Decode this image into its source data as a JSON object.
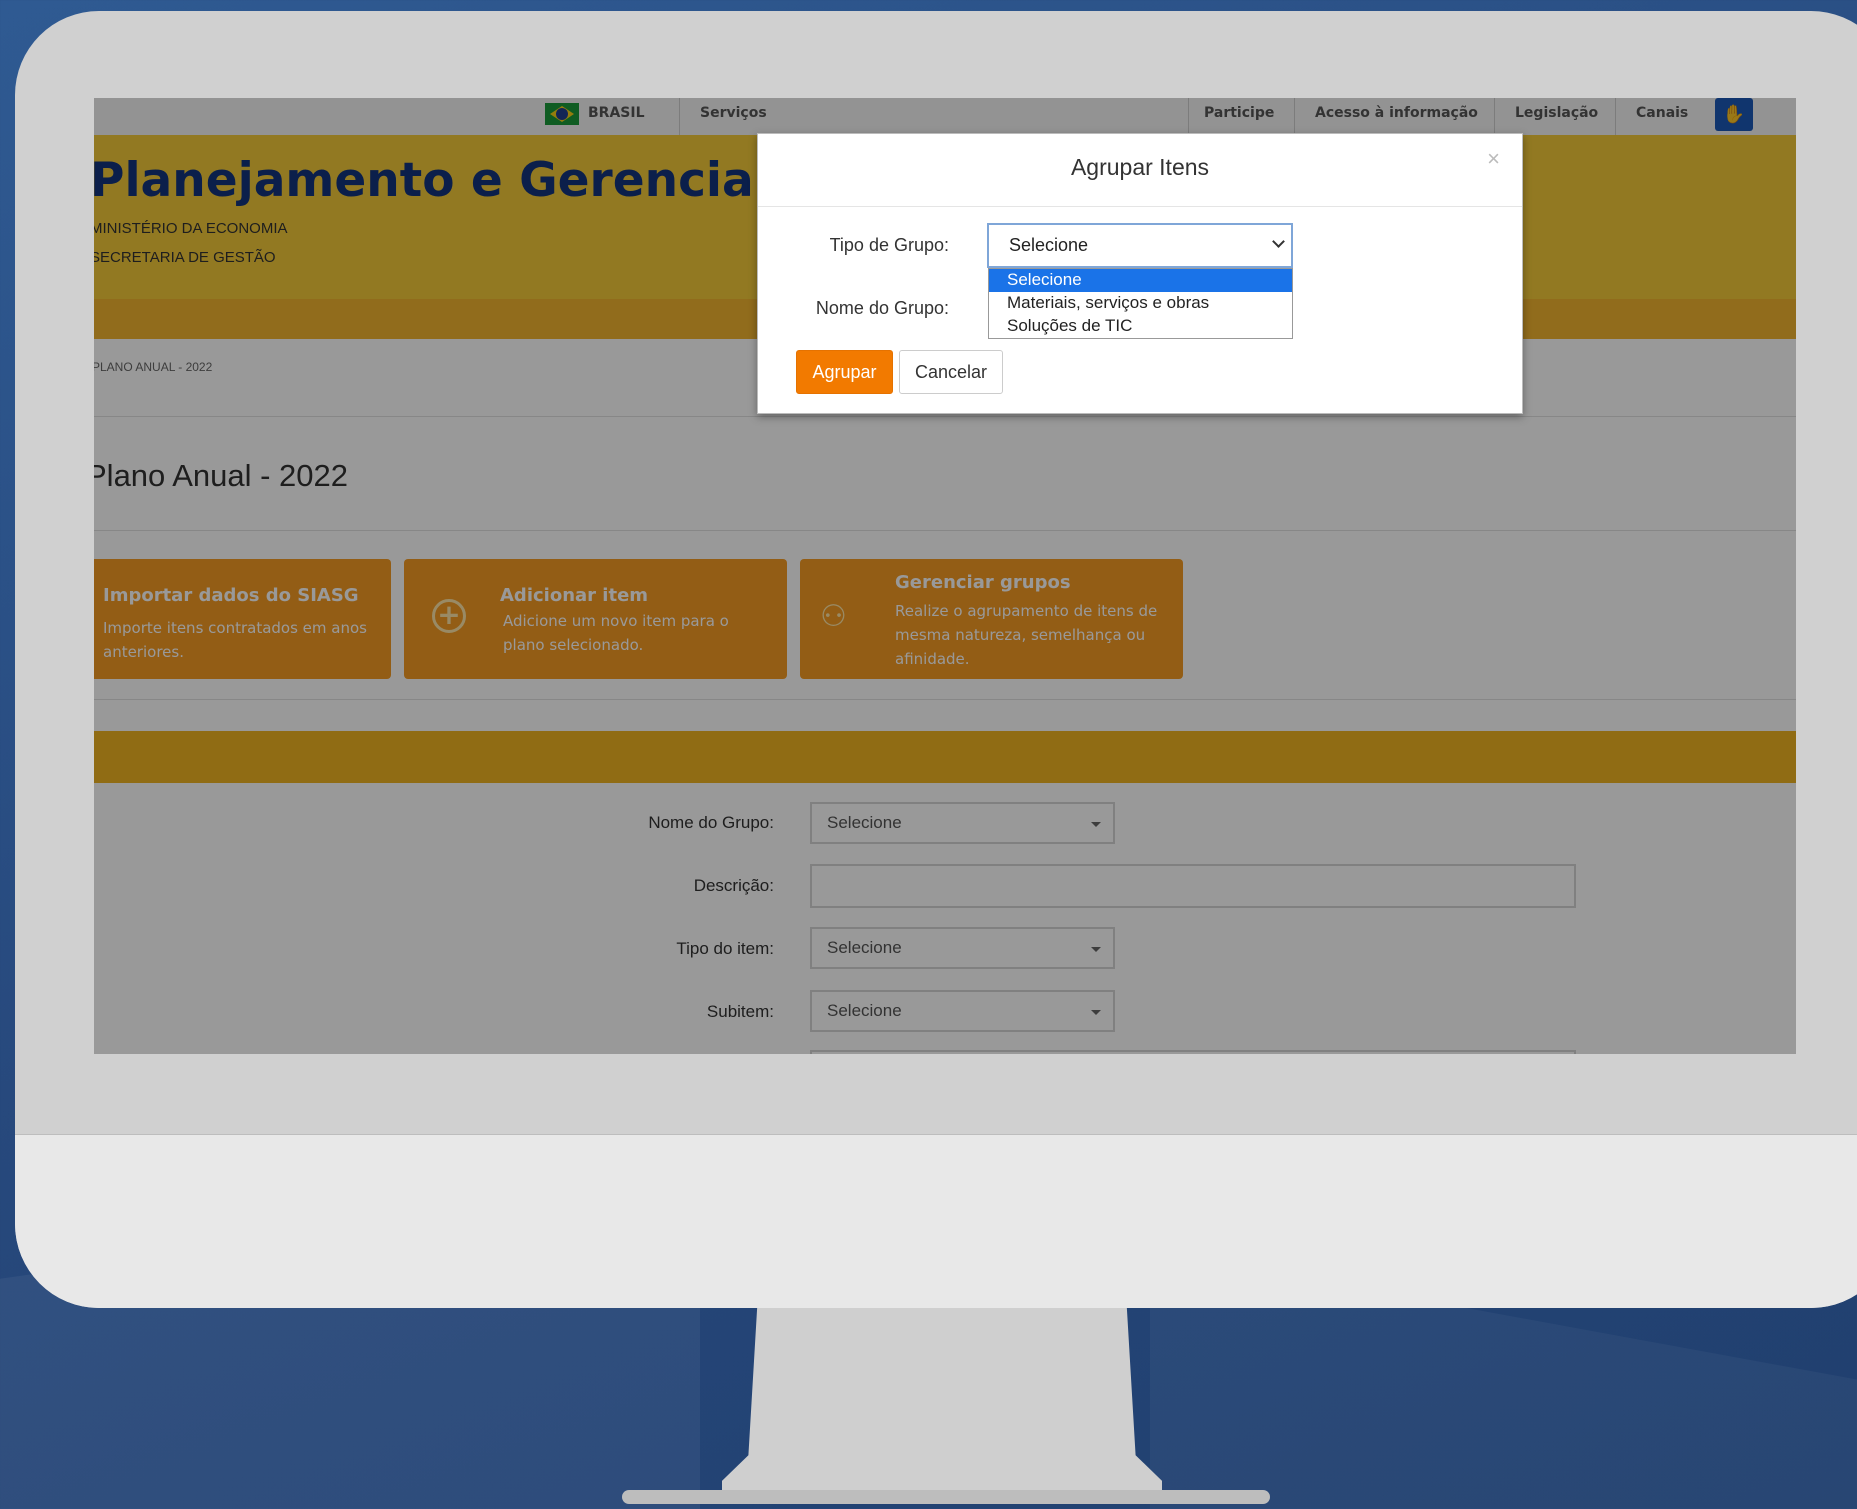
{
  "topbar": {
    "country": "BRASIL",
    "services": "Serviços",
    "links": [
      "Participe",
      "Acesso à informação",
      "Legislação",
      "Canais"
    ]
  },
  "header": {
    "title": "Planejamento e Gerenciamento",
    "ministry": "MINISTÉRIO DA ECONOMIA",
    "secretariat": "SECRETARIA DE GESTÃO"
  },
  "breadcrumb": "PLANO ANUAL - 2022",
  "page_title": "Plano Anual - 2022",
  "cards": [
    {
      "title": "Importar dados do SIASG",
      "description": "Importe itens contratados em anos anteriores."
    },
    {
      "title": "Adicionar item",
      "description": "Adicione um novo item para o plano selecionado."
    },
    {
      "title": "Gerenciar grupos",
      "description": "Realize o agrupamento de itens de mesma natureza, semelhança ou afinidade."
    }
  ],
  "form": {
    "group_name_label": "Nome do Grupo:",
    "group_name_value": "Selecione",
    "description_label": "Descrição:",
    "item_type_label": "Tipo do item:",
    "item_type_value": "Selecione",
    "subitem_label": "Subitem:",
    "subitem_value": "Selecione"
  },
  "modal": {
    "title": "Agrupar Itens",
    "close": "×",
    "group_type_label": "Tipo de Grupo:",
    "group_type_value": "Selecione",
    "group_name_label": "Nome do Grupo:",
    "options": [
      "Selecione",
      "Materiais, serviços e obras",
      "Soluções de TIC"
    ],
    "submit_label": "Agrupar",
    "cancel_label": "Cancelar"
  },
  "colors": {
    "background": "#27497d",
    "header_yellow": "#f4ca3a",
    "card_orange": "#f59c24",
    "primary_button": "#f27a00",
    "title_blue": "#13357e"
  }
}
